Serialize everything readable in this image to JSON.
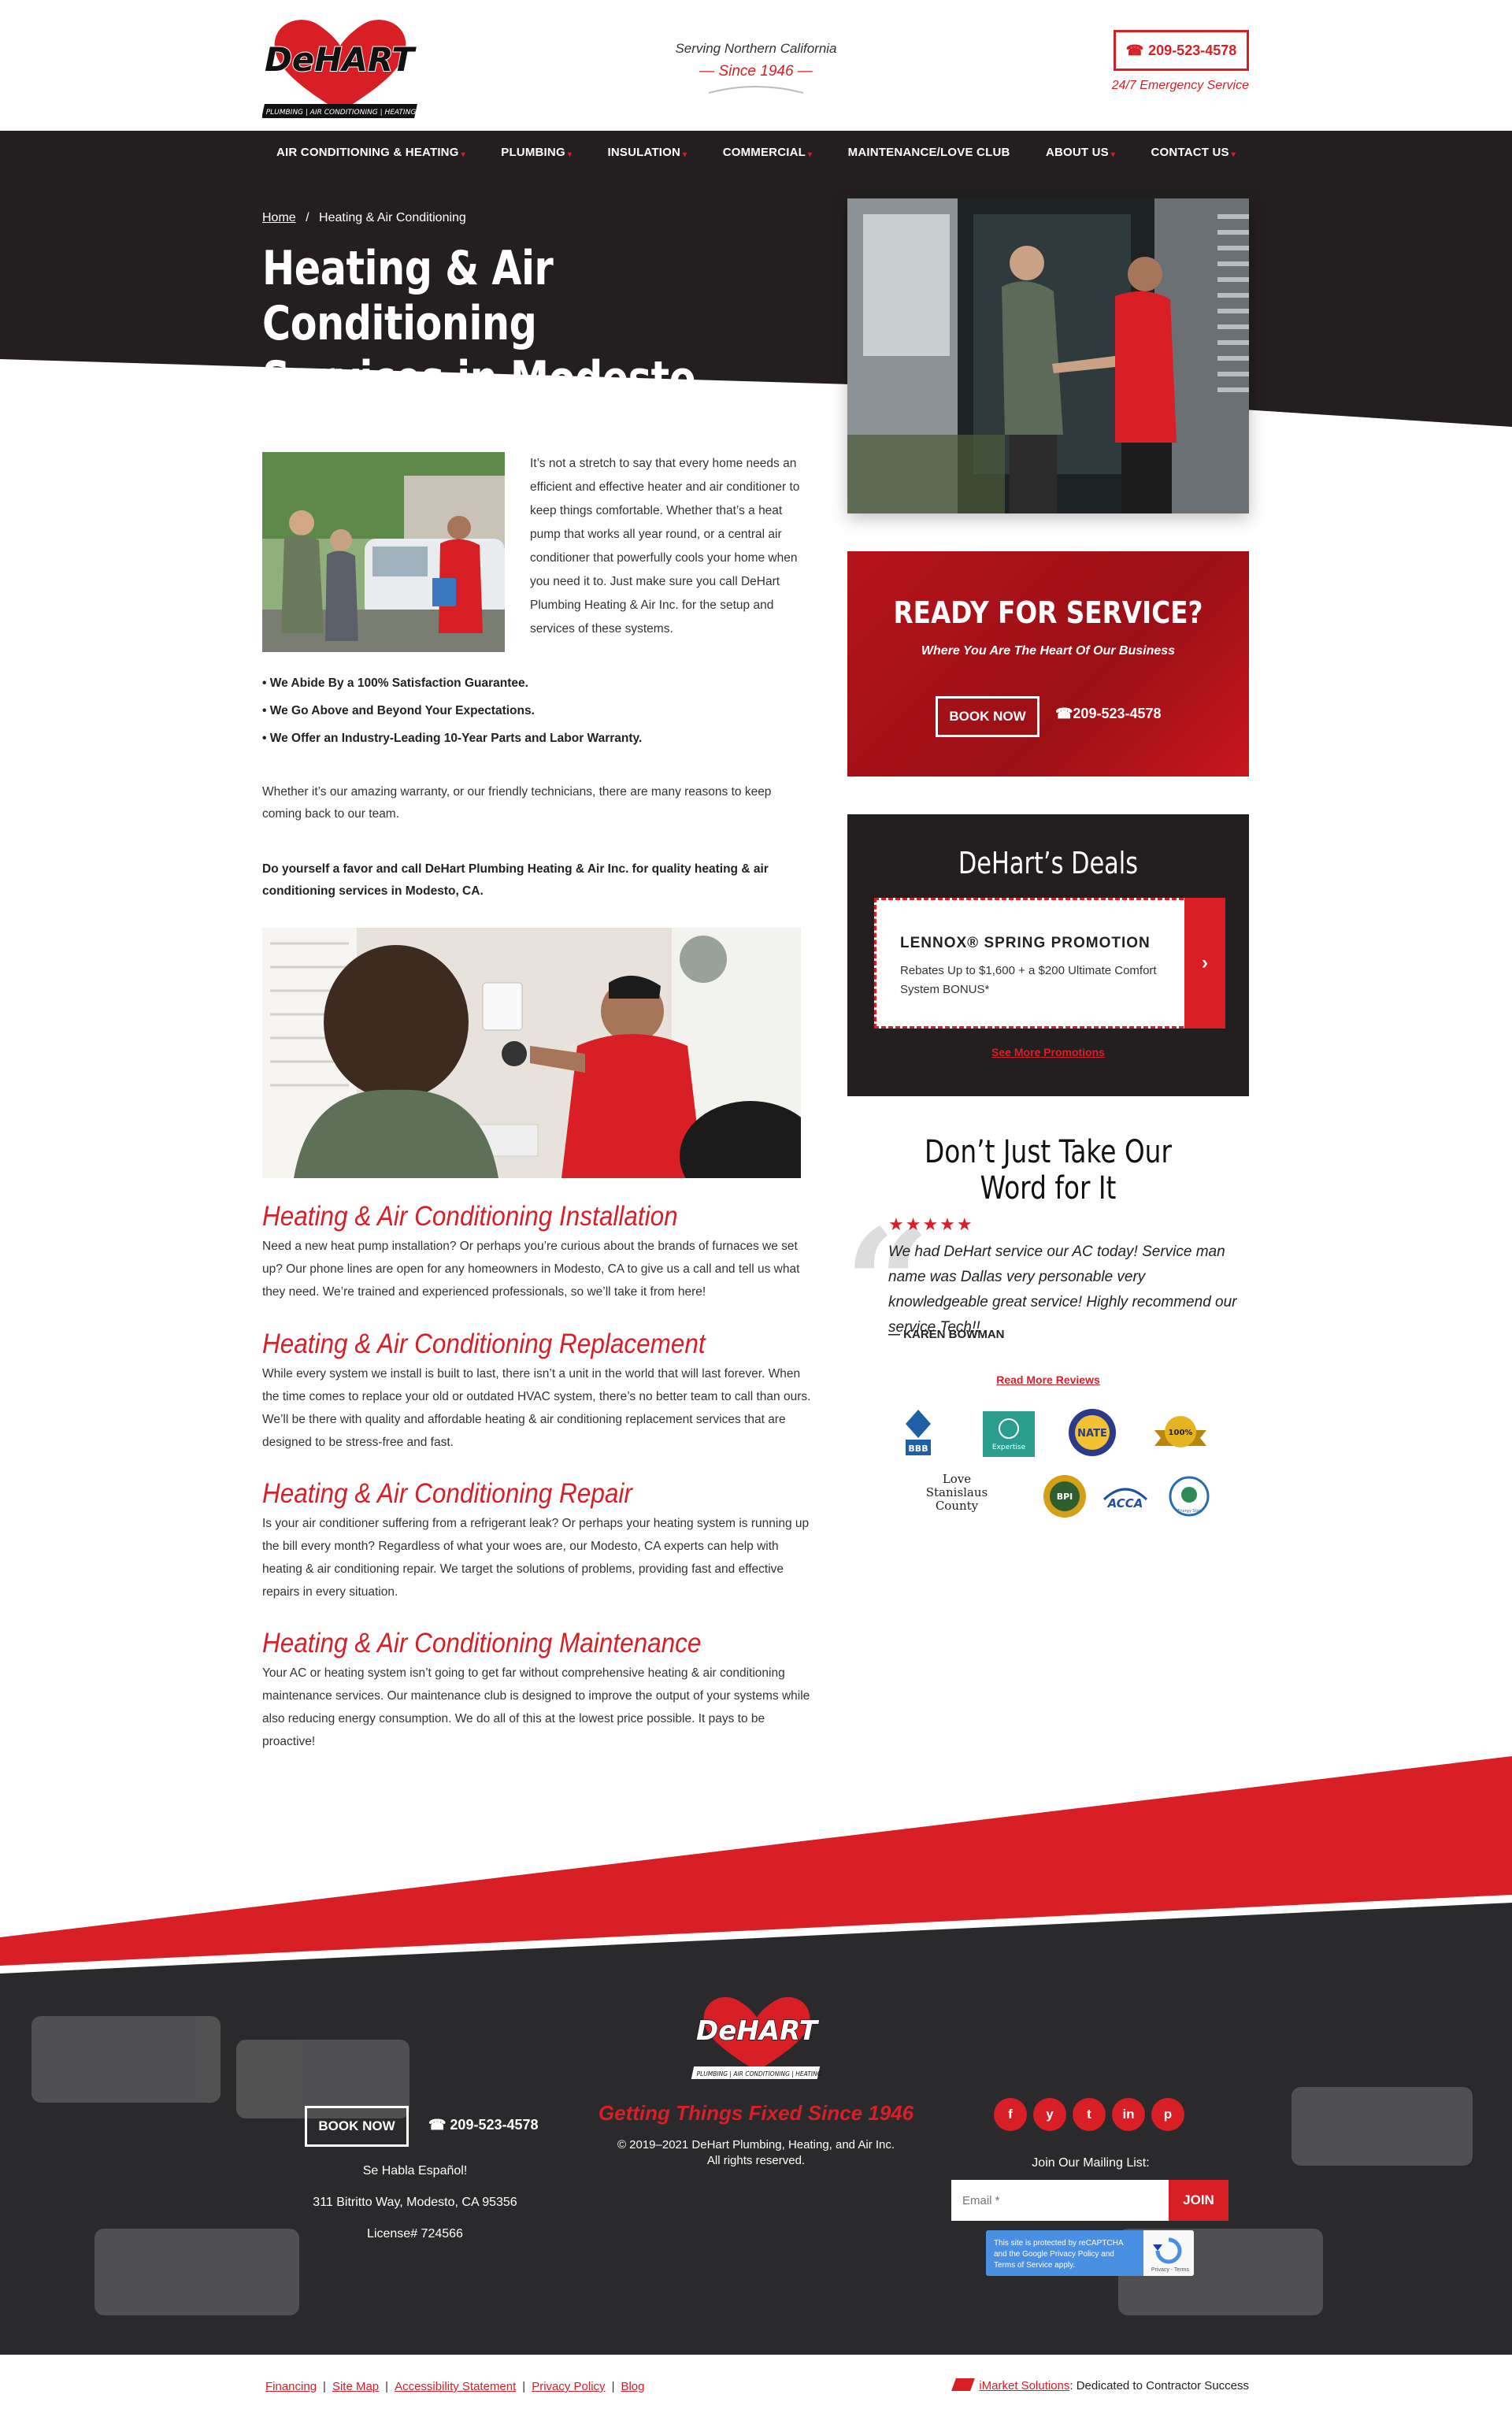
{
  "header": {
    "brand": "DeHart",
    "brand_sub": "PLUMBING | AIR CONDITIONING | HEATING",
    "tagline_top": "Serving Northern California",
    "tagline_since": "— Since 1946 —",
    "phone": "209-523-4578",
    "phone_icon": "phone-icon",
    "emergency": "24/7 Emergency Service"
  },
  "nav": [
    {
      "label": "AIR CONDITIONING & HEATING",
      "dropdown": true
    },
    {
      "label": "PLUMBING",
      "dropdown": true
    },
    {
      "label": "INSULATION",
      "dropdown": true
    },
    {
      "label": "COMMERCIAL",
      "dropdown": true
    },
    {
      "label": "MAINTENANCE/LOVE CLUB",
      "dropdown": false
    },
    {
      "label": "ABOUT US",
      "dropdown": true
    },
    {
      "label": "CONTACT US",
      "dropdown": true
    }
  ],
  "breadcrumb": {
    "home": "Home",
    "separator": "/",
    "current": "Heating & Air Conditioning"
  },
  "hero": {
    "title_line1": "Heating & Air Conditioning",
    "title_line2": "Services in Modesto, CA"
  },
  "main": {
    "intro": "It’s not a stretch to say that every home needs an efficient and effective heater and air conditioner to keep things comfortable. Whether that’s a heat pump that works all year round, or a central air conditioner that powerfully cools your home when you need it to. Just make sure you call DeHart Plumbing Heating & Air Inc. for the setup and services of these systems.",
    "bullets": [
      "• We Abide By a 100% Satisfaction Guarantee.",
      "• We Go Above and Beyond Your Expectations.",
      "• We Offer an Industry-Leading 10-Year Parts and Labor Warranty."
    ],
    "para2": "Whether it’s our amazing warranty, or our friendly technicians, there are many reasons to keep coming back to our team.",
    "para3": "Do yourself a favor and call DeHart Plumbing Heating & Air Inc. for quality heating & air conditioning services in Modesto, CA.",
    "sections": [
      {
        "title": "Heating & Air Conditioning Installation",
        "body": "Need a new heat pump installation? Or perhaps you’re curious about the brands of furnaces we set up? Our phone lines are open for any homeowners in Modesto, CA to give us a call and tell us what they need. We’re trained and experienced professionals, so we’ll take it from here!"
      },
      {
        "title": "Heating & Air Conditioning Replacement",
        "body": "While every system we install is built to last, there isn’t a unit in the world that will last forever. When the time comes to replace your old or outdated HVAC system, there’s no better team to call than ours. We’ll be there with quality and affordable heating & air conditioning replacement services that are designed to be stress-free and fast."
      },
      {
        "title": "Heating & Air Conditioning Repair",
        "body": "Is your air conditioner suffering from a refrigerant leak? Or perhaps your heating system is running up the bill every month? Regardless of what your woes are, our Modesto, CA experts can help with heating & air conditioning repair. We target the solutions of problems, providing fast and effective repairs in every situation."
      },
      {
        "title": "Heating & Air Conditioning Maintenance",
        "body": "Your AC or heating system isn’t going to get far without comprehensive heating & air conditioning maintenance services. Our maintenance club is designed to improve the output of your systems while also reducing energy consumption. We do all of this at the lowest price possible. It pays to be proactive!"
      }
    ]
  },
  "ready": {
    "title": "READY FOR SERVICE?",
    "subtitle": "Where You Are The Heart Of Our Business",
    "book": "BOOK NOW",
    "phone": "☎209-523-4578"
  },
  "deals": {
    "title": "DeHart’s Deals",
    "card_title": "LENNOX® SPRING PROMOTION",
    "card_desc": "Rebates Up to $1,600 + a $200 Ultimate Comfort System BONUS*",
    "arrow": "›",
    "see_more": "See More Promotions"
  },
  "reviews": {
    "title_line1": "Don’t Just Take Our",
    "title_line2": "Word for It",
    "stars": "★★★★★",
    "text": "We had DeHart service our AC today! Service man name was Dallas very personable very knowledgeable great service! Highly recommend our service Tech!!",
    "author": "— KAREN BOWMAN",
    "read_more": "Read More Reviews",
    "badges": [
      "BBB",
      "Expertise",
      "NATE",
      "100%",
      "Love Stanislaus County",
      "BPI",
      "ACCA",
      "Energy Star"
    ]
  },
  "footer": {
    "brand": "DeHart",
    "brand_sub": "PLUMBING | AIR CONDITIONING | HEATING",
    "book": "BOOK NOW",
    "phone": "☎ 209-523-4578",
    "spanish": "Se Habla Español!",
    "address": "311 Bitritto Way, Modesto, CA 95356",
    "license": "License# 724566",
    "slogan": "Getting Things Fixed Since 1946",
    "copy_line1": "© 2019–2021 DeHart Plumbing, Heating, and Air Inc.",
    "copy_line2": "All rights reserved.",
    "social": [
      "f",
      "y",
      "t",
      "in",
      "p"
    ],
    "social_names": [
      "facebook-icon",
      "yelp-icon",
      "twitter-icon",
      "linkedin-icon",
      "pinterest-icon"
    ],
    "join_label": "Join Our Mailing List:",
    "email_placeholder": "Email *",
    "join": "JOIN",
    "captcha_text": "This site is protected by reCAPTCHA and the Google Privacy Policy and Terms of Service apply.",
    "captcha_mini": "Privacy - Terms"
  },
  "bottom": {
    "links": [
      "Financing",
      "Site Map",
      "Accessibility Statement",
      "Privacy Policy",
      "Blog"
    ],
    "credit_link": "iMarket Solutions",
    "credit_text": ": Dedicated to Contractor Success"
  },
  "colors": {
    "brand_red": "#d81f26",
    "dark": "#231f20"
  }
}
